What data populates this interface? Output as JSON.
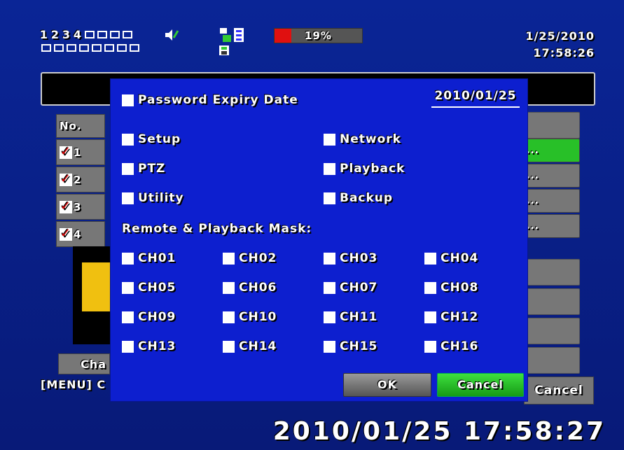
{
  "status": {
    "channel_numbers": [
      "1",
      "2",
      "3",
      "4"
    ],
    "hdd_usage_text": "19%",
    "hdd_usage_fraction": 0.19,
    "date": "1/25/2010",
    "time": "17:58:26"
  },
  "background": {
    "table_header": "No.",
    "rows": [
      "1",
      "2",
      "3",
      "4"
    ],
    "row_check_mark": "✓",
    "button_label": "...",
    "change_button": "Cha",
    "menu_hint": "[MENU] C",
    "cancel_button": "Cancel",
    "osd_datetime": "2010/01/25  17:58:27"
  },
  "dialog": {
    "expiry_label": "Password Expiry Date",
    "expiry_date": "2010/01/25",
    "permissions": [
      {
        "label": "Setup"
      },
      {
        "label": "Network"
      },
      {
        "label": "PTZ"
      },
      {
        "label": "Playback"
      },
      {
        "label": "Utility"
      },
      {
        "label": "Backup"
      }
    ],
    "mask_label": "Remote & Playback Mask:",
    "channels": [
      "CH01",
      "CH02",
      "CH03",
      "CH04",
      "CH05",
      "CH06",
      "CH07",
      "CH08",
      "CH09",
      "CH10",
      "CH11",
      "CH12",
      "CH13",
      "CH14",
      "CH15",
      "CH16"
    ],
    "ok_label": "OK",
    "cancel_label": "Cancel"
  },
  "colors": {
    "background": "#0a2596",
    "dialog": "#0d1fcf",
    "accent_green": "#28c028",
    "hdd_red": "#e01010"
  },
  "icons": {
    "speaker": "speaker-muted-icon",
    "network": "network-icon",
    "film": "film-icon",
    "disk": "disk-icon"
  }
}
